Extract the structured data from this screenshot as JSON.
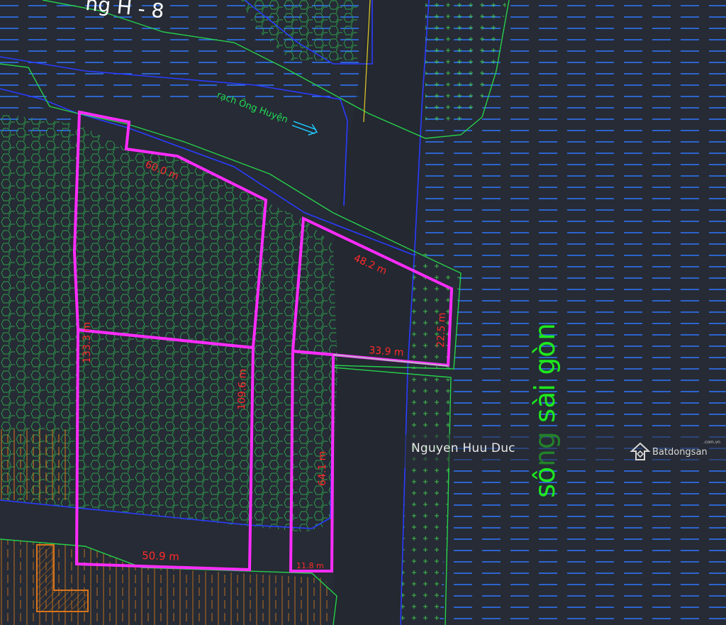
{
  "labels": {
    "road_top": "ng H - 8",
    "canal": "rạch Ông Huyện",
    "river": "sông sài gòn"
  },
  "dimensions": {
    "d_60": "60.0 m",
    "d_48": "48.2 m",
    "d_22": "22.5 m",
    "d_33": "33.9 m",
    "d_133": "133.3 m",
    "d_109": "109.6 m",
    "d_64": "64.1 m",
    "d_50": "50.9 m",
    "d_11": "11.8 m"
  },
  "watermark": {
    "author": "Nguyen Huu Duc",
    "brand": "Batdongsan",
    "domain": ".com.vn"
  },
  "colors": {
    "background": "#262b35",
    "boundary": "#ff2cff",
    "dimension_text": "#ff2a2a",
    "river_text": "#1ee81e",
    "canal_text": "#22dd55",
    "water_dash": "#2f78ff",
    "vegetation": "#2fa84f",
    "field_lines": "#e07a1a"
  }
}
